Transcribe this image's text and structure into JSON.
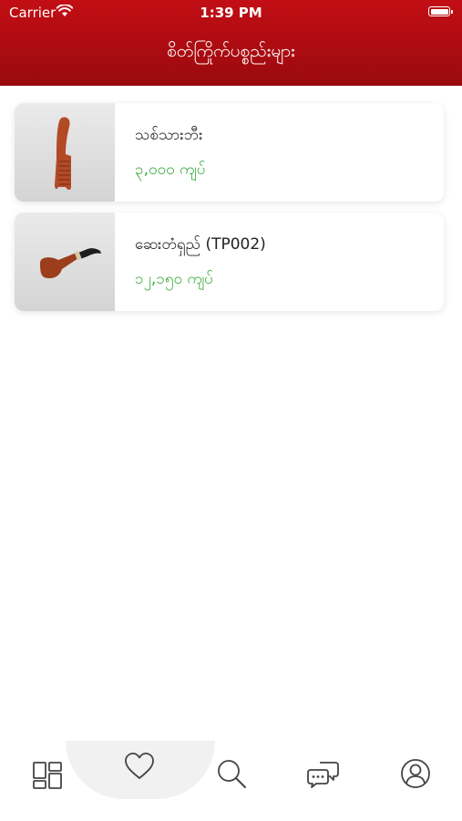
{
  "status": {
    "carrier": "Carrier",
    "time": "1:39 PM"
  },
  "header": {
    "title": "စိတ်ကြိုက်ပစ္စည်းများ"
  },
  "favorites": [
    {
      "name": "သစ်သားဘီး",
      "price": "၃,၀၀၀ ကျပ်",
      "image_icon": "comb-image"
    },
    {
      "name": "ဆေးတံရှည် (TP002)",
      "price": "၁၂,၁၅၀ ကျပ်",
      "image_icon": "pipe-image"
    }
  ],
  "tabbar": {
    "tabs": [
      "grid-icon",
      "heart-icon",
      "search-icon",
      "chat-icon",
      "profile-icon"
    ],
    "active": "heart-icon"
  },
  "colors": {
    "header": "#b10d12",
    "price": "#3aaa3c",
    "icon": "#444444"
  }
}
